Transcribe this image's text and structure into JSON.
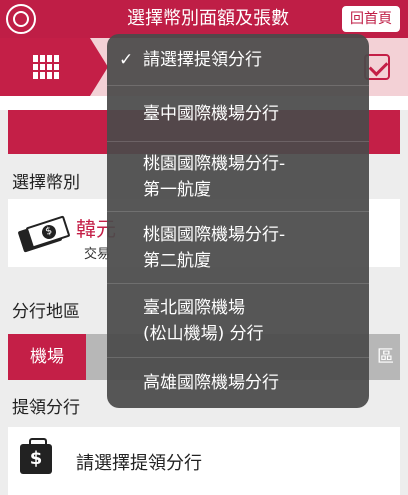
{
  "header": {
    "title": "選擇幣別面額及張數",
    "home_label": "回首頁"
  },
  "labels": {
    "currency": "選擇幣別",
    "area": "分行地區",
    "branch": "提領分行"
  },
  "currency": {
    "name": "韓元",
    "sub": "交易"
  },
  "area_tabs": {
    "tab1": "機場",
    "tab2": "區"
  },
  "branch_placeholder": "請選擇提領分行",
  "dropdown": {
    "selected_mark": "✓",
    "options": [
      {
        "line1": "請選擇提領分行",
        "line2": ""
      },
      {
        "line1": "臺中國際機場分行",
        "line2": ""
      },
      {
        "line1": "桃園國際機場分行-",
        "line2": "第一航廈"
      },
      {
        "line1": "桃園國際機場分行-",
        "line2": "第二航廈"
      },
      {
        "line1": "臺北國際機場",
        "line2": "(松山機場) 分行"
      },
      {
        "line1": "高雄國際機場分行",
        "line2": ""
      }
    ]
  },
  "colors": {
    "brand": "#bf1e46",
    "tab_gray": "#b7b7b7",
    "dropdown_bg": "#4a4a4a"
  }
}
